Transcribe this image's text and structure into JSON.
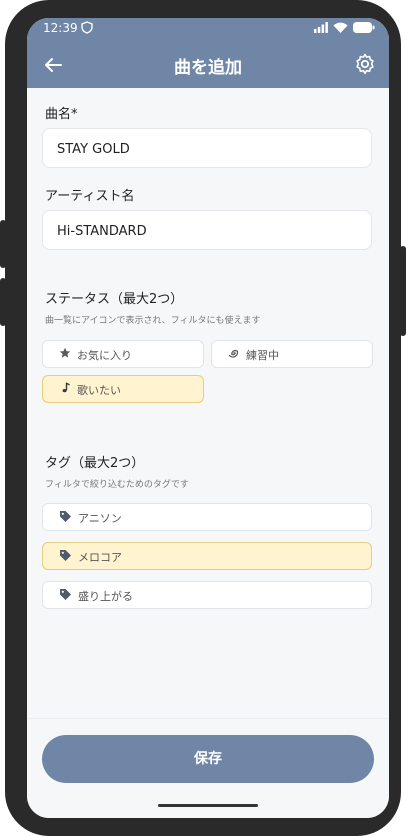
{
  "status": {
    "time": "12:39"
  },
  "header": {
    "title": "曲を追加",
    "back_icon": "arrow-left-icon",
    "settings_icon": "gear-icon"
  },
  "form": {
    "song_label": "曲名*",
    "song_value": "STAY GOLD",
    "artist_label": "アーティスト名",
    "artist_value": "Hi-STANDARD",
    "status_label": "ステータス（最大2つ）",
    "status_sub": "曲一覧にアイコンで表示され、フィルタにも使えます",
    "status_options": [
      {
        "label": "お気に入り",
        "icon": "star-icon",
        "selected": false
      },
      {
        "label": "練習中",
        "icon": "swirl-icon",
        "selected": false
      },
      {
        "label": "歌いたい",
        "icon": "music-note-icon",
        "selected": true
      }
    ],
    "tag_label": "タグ（最大2つ）",
    "tag_sub": "フィルタで絞り込むためのタグです",
    "tags": [
      {
        "label": "アニソン",
        "icon": "tag-icon",
        "selected": false
      },
      {
        "label": "メロコア",
        "icon": "tag-icon",
        "selected": true
      },
      {
        "label": "盛り上がる",
        "icon": "tag-icon",
        "selected": false
      }
    ]
  },
  "footer": {
    "save_label": "保存"
  },
  "colors": {
    "header": "#6f86a6",
    "selected_bg": "#fff3d0",
    "selected_border": "#e7cd7e"
  }
}
